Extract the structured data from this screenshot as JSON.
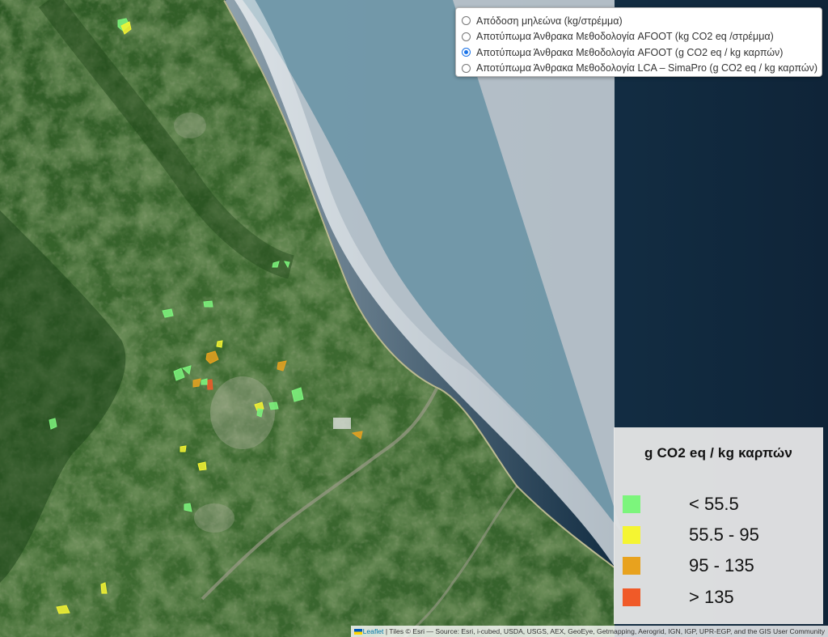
{
  "layer_control": {
    "options": [
      {
        "label": "Απόδοση μηλεώνα (kg/στρέμμα)",
        "checked": false
      },
      {
        "label": "Αποτύπωμα Άνθρακα Μεθοδολογία AFOOT (kg CO2 eq /στρέμμα)",
        "checked": false
      },
      {
        "label": "Αποτύπωμα Άνθρακα Μεθοδολογία AFOOT (g CO2 eq / kg καρπών)",
        "checked": true
      },
      {
        "label": "Αποτύπωμα Άνθρακα Μεθοδολογία LCA – SimaPro (g CO2 eq / kg καρπών)",
        "checked": false
      }
    ]
  },
  "legend": {
    "title": "g CO2 eq / kg καρπών",
    "classes": [
      {
        "label": "< 55.5",
        "color": "#7cf57c"
      },
      {
        "label": "55.5 - 95",
        "color": "#f5f532"
      },
      {
        "label": "95 - 135",
        "color": "#e8a21e"
      },
      {
        "label": "> 135",
        "color": "#f05a28"
      }
    ]
  },
  "attribution": {
    "leaflet": "Leaflet",
    "text": " | Tiles © Esri — Source: Esri, i-cubed, USDA, USGS, AEX, GeoEye, Getmapping, Aerogrid, IGN, IGP, UPR-EGP, and the GIS User Community"
  },
  "parcels": [
    {
      "cls": 0
    },
    {
      "cls": 1
    },
    {
      "cls": 0
    },
    {
      "cls": 0
    },
    {
      "cls": 0
    },
    {
      "cls": 0
    },
    {
      "cls": 1
    },
    {
      "cls": 2
    },
    {
      "cls": 2
    },
    {
      "cls": 0
    },
    {
      "cls": 0
    },
    {
      "cls": 2
    },
    {
      "cls": 3
    },
    {
      "cls": 0
    },
    {
      "cls": 1
    },
    {
      "cls": 0
    },
    {
      "cls": 0
    },
    {
      "cls": 0
    },
    {
      "cls": 2
    },
    {
      "cls": 1
    },
    {
      "cls": 1
    },
    {
      "cls": 0
    },
    {
      "cls": 1
    },
    {
      "cls": 0
    },
    {
      "cls": 1
    }
  ]
}
